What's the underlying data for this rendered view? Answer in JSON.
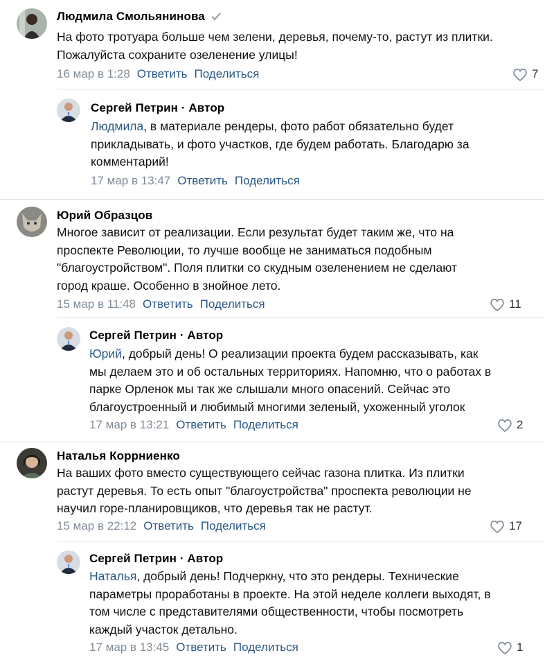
{
  "comments": [
    {
      "author": "Людмила Смольянинова",
      "text": "На фото тротуара больше чем зелени, деревья, почему-то, растут из плитки.\nПожалуйста сохраните озеленение улицы!",
      "date": "16 мар в 1:28",
      "reply_label": "Ответить",
      "share_label": "Поделиться",
      "likes": "7"
    },
    {
      "author": "Сергей Петрин · Автор",
      "mention": "Людмила",
      "text": ", в материале рендеры, фото работ обязательно будет\nприкладывать, и фото участков, где будем работать. Благодарю за\nкомментарий!",
      "date": "17 мар в 13:47",
      "reply_label": "Ответить",
      "share_label": "Поделиться"
    },
    {
      "author": "Юрий Образцов",
      "text": "Многое зависит от реализации. Если результат будет таким же, что на\nпроспекте Революции, то лучше вообще не заниматься подобным\n\"благоустройством\". Поля плитки со скудным озеленением не сделают\nгород краше. Особенно в знойное лето.",
      "date": "15 мар в 11:48",
      "reply_label": "Ответить",
      "share_label": "Поделиться",
      "likes": "11"
    },
    {
      "author": "Сергей Петрин · Автор",
      "mention": "Юрий",
      "text": ", добрый день! О реализации проекта будем рассказывать, как\nмы делаем это и об остальных территориях. Напомню, что о работах в\nпарке Орленок мы так же слышали много опасений. Сейчас это\nблагоустроенный и любимый многими зеленый, ухоженный уголок",
      "date": "17 мар в 13:21",
      "reply_label": "Ответить",
      "share_label": "Поделиться",
      "likes": "2"
    },
    {
      "author": "Наталья Коррниенко",
      "text": "На ваших фото вместо существующего сейчас газона плитка. Из плитки\nрастут деревья. То есть опыт \"благоустройства\" проспекта революции не\nнаучил горе-планировщиков, что деревья так не растут.",
      "date": "15 мар в 22:12",
      "reply_label": "Ответить",
      "share_label": "Поделиться",
      "likes": "17"
    },
    {
      "author": "Сергей Петрин · Автор",
      "mention": "Наталья",
      "text": ", добрый день! Подчеркну, что это рендеры. Технические\nпараметры проработаны в проекте. На этой неделе коллеги выходят, в\nтом числе с представителями общественности, чтобы посмотреть\nкаждый участок детально.",
      "date": "17 мар в 13:45",
      "reply_label": "Ответить",
      "share_label": "Поделиться",
      "likes": "1"
    }
  ],
  "colors": {
    "link": "#2a5885",
    "meta": "#818c99",
    "divider": "#dce1e6"
  }
}
